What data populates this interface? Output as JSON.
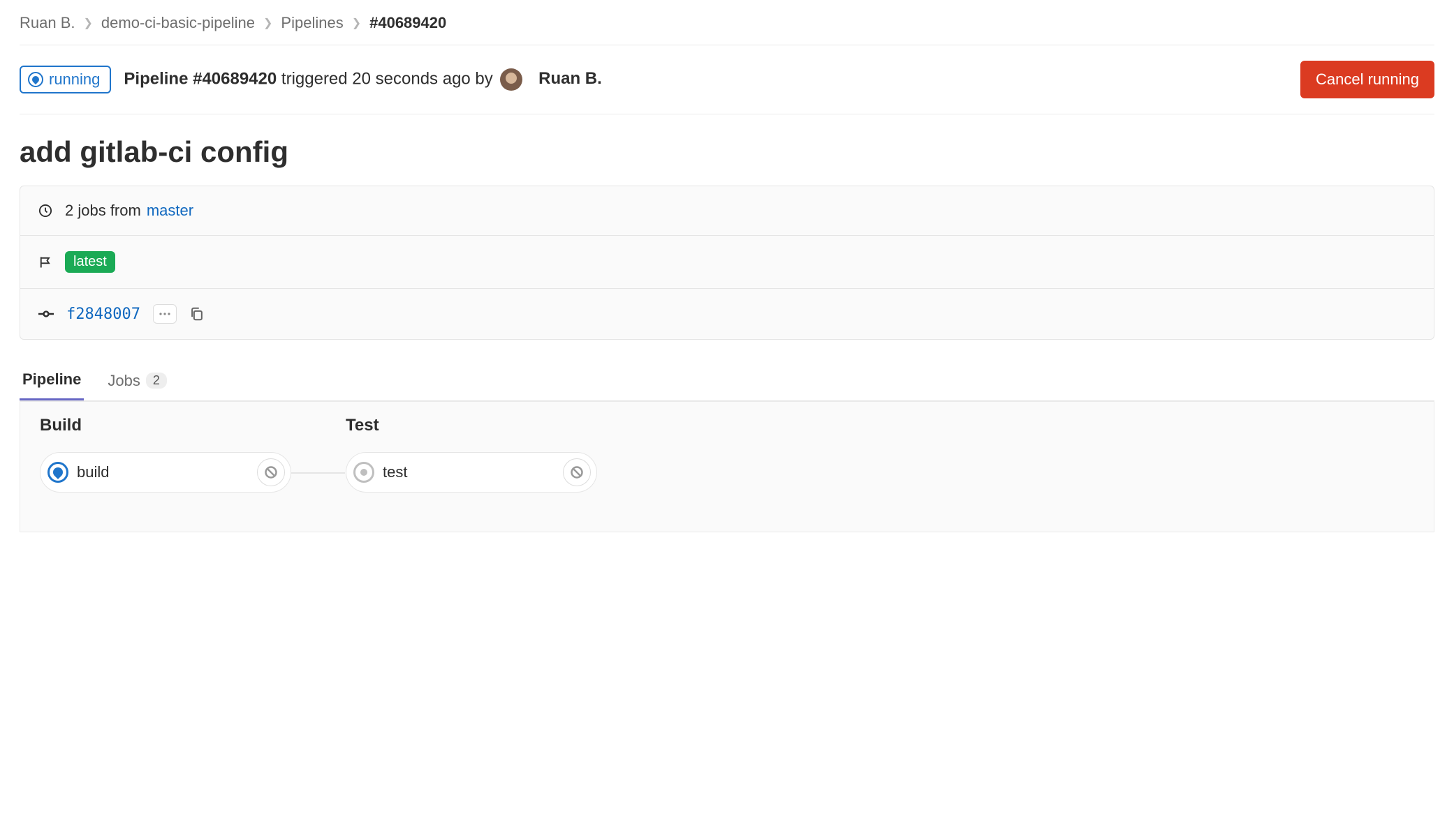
{
  "breadcrumb": {
    "owner": "Ruan B.",
    "project": "demo-ci-basic-pipeline",
    "section": "Pipelines",
    "current": "#40689420"
  },
  "header": {
    "status": "running",
    "pipeline_label": "Pipeline",
    "pipeline_id": "#40689420",
    "triggered_text": "triggered 20 seconds ago by",
    "author": "Ruan B.",
    "cancel_button": "Cancel running"
  },
  "commit": {
    "title": "add gitlab-ci config"
  },
  "info": {
    "jobs_text": "2 jobs from",
    "branch": "master",
    "tag": "latest",
    "commit_hash": "f2848007"
  },
  "tabs": {
    "pipeline": "Pipeline",
    "jobs": "Jobs",
    "jobs_count": "2"
  },
  "graph": {
    "stages": [
      {
        "title": "Build",
        "jobs": [
          {
            "name": "build",
            "status": "running"
          }
        ]
      },
      {
        "title": "Test",
        "jobs": [
          {
            "name": "test",
            "status": "created"
          }
        ]
      }
    ]
  }
}
